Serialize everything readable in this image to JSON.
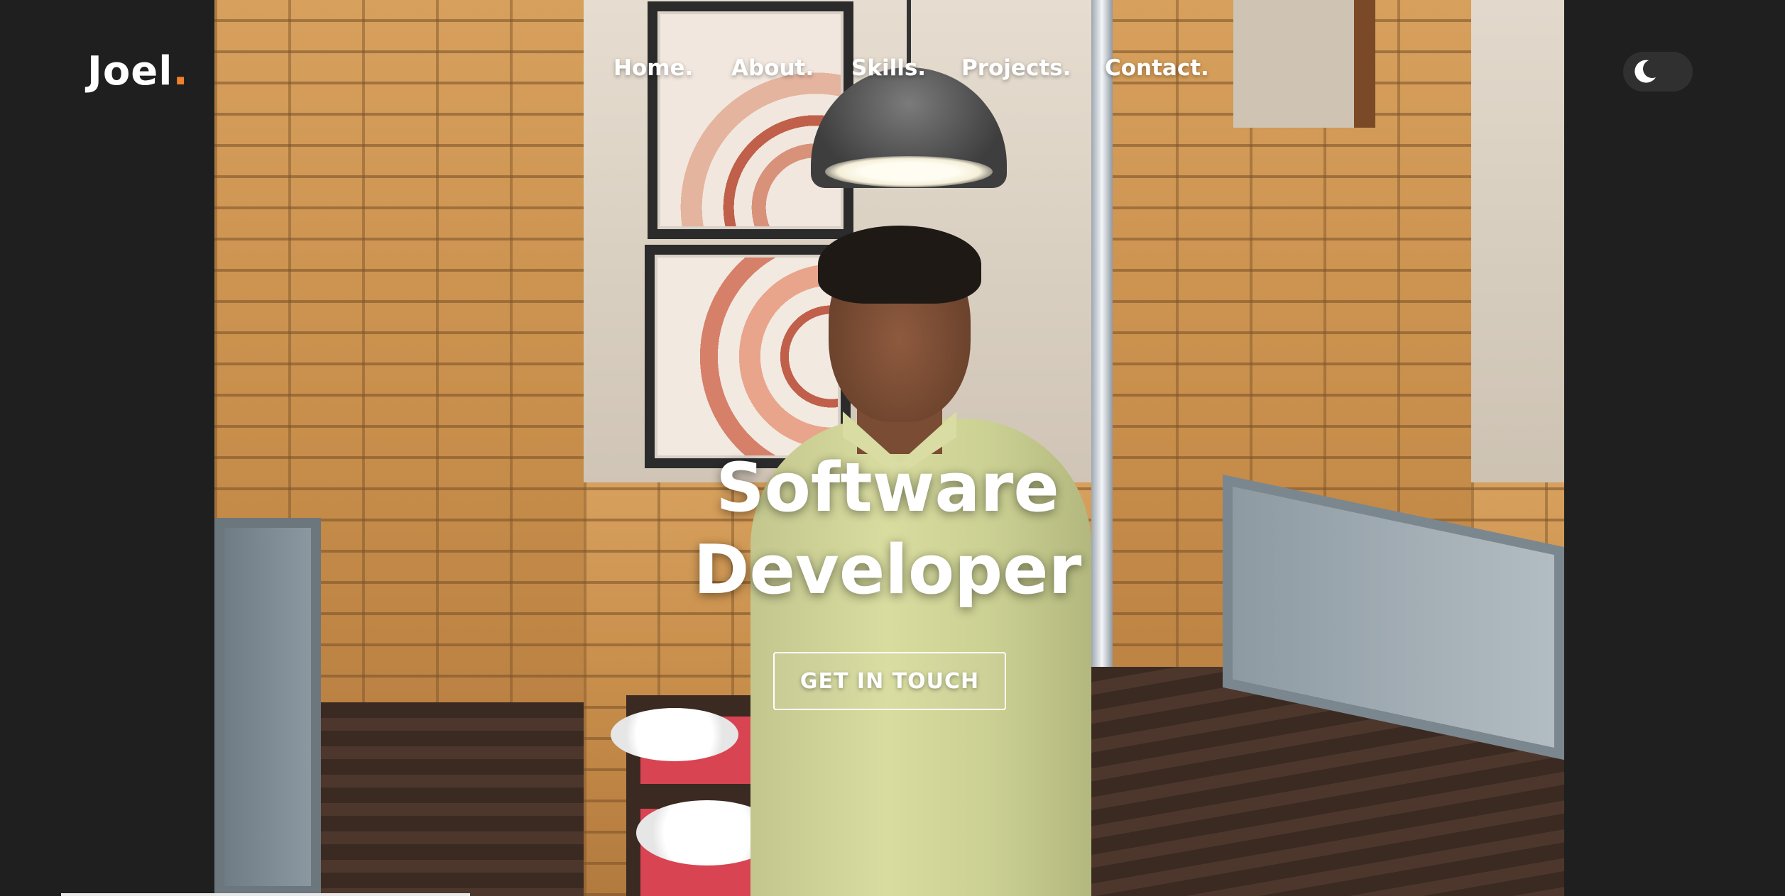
{
  "header": {
    "logo_text": "Joel",
    "logo_dot": ".",
    "logo_dot_color": "#f0822c"
  },
  "nav": {
    "items": [
      {
        "label": "Home."
      },
      {
        "label": "About."
      },
      {
        "label": "Skills."
      },
      {
        "label": "Projects."
      },
      {
        "label": "Contact."
      }
    ]
  },
  "theme_toggle": {
    "icon": "moon-icon",
    "mode": "dark"
  },
  "hero": {
    "title_line1": "Software",
    "title_line2": "Developer",
    "cta_label": "GET IN TOUCH",
    "image_subject": "portrait-photo"
  },
  "colors": {
    "background": "#1f1f1f",
    "text": "#ffffff",
    "accent": "#f0822c"
  }
}
